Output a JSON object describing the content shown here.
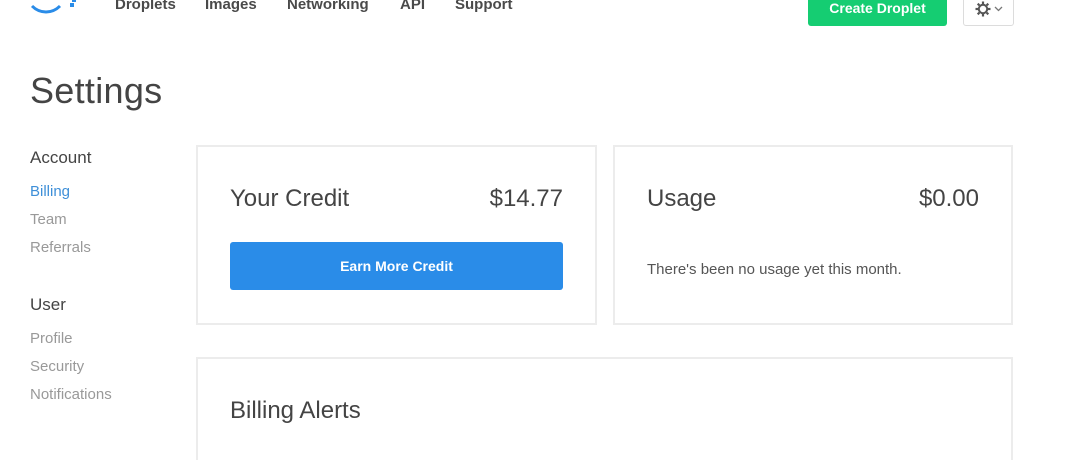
{
  "nav": {
    "logo_icon": "digitalocean-logo-icon",
    "links": [
      "Droplets",
      "Images",
      "Networking",
      "API",
      "Support"
    ],
    "create_label": "Create Droplet",
    "settings_icon": "gear-icon",
    "dropdown_icon": "chevron-down-icon"
  },
  "page": {
    "title": "Settings"
  },
  "sidebar": {
    "sections": [
      {
        "heading": "Account",
        "items": [
          "Billing",
          "Team",
          "Referrals"
        ]
      },
      {
        "heading": "User",
        "items": [
          "Profile",
          "Security",
          "Notifications"
        ]
      }
    ],
    "active_item": "Billing"
  },
  "credit": {
    "title": "Your Credit",
    "amount": "$14.77",
    "button_label": "Earn More Credit"
  },
  "usage": {
    "title": "Usage",
    "amount": "$0.00",
    "note": "There's been no usage yet this month."
  },
  "alerts": {
    "title": "Billing Alerts"
  },
  "colors": {
    "brand_green": "#15cd72",
    "primary_blue": "#2a8ce8",
    "link_active": "#3e8fd8",
    "logo_blue": "#2a8ce8"
  }
}
